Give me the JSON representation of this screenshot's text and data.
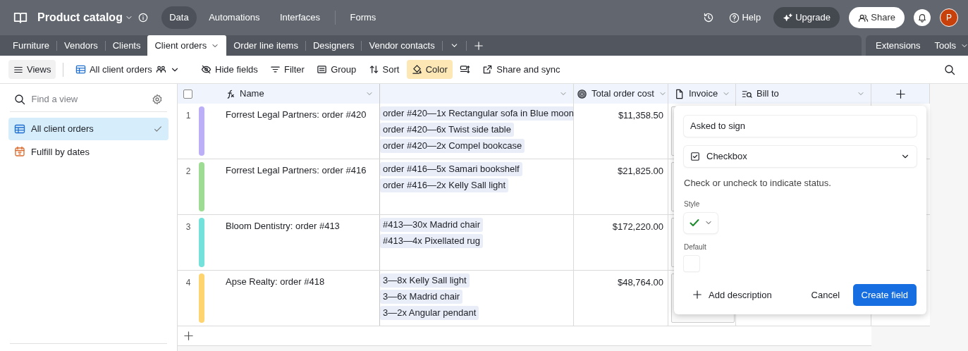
{
  "app": {
    "title": "Product catalog",
    "nav": [
      {
        "label": "Data",
        "selected": true
      },
      {
        "label": "Automations",
        "selected": false
      },
      {
        "label": "Interfaces",
        "selected": false
      },
      {
        "label": "Forms",
        "selected": false
      }
    ]
  },
  "header_actions": {
    "help": "Help",
    "upgrade": "Upgrade",
    "share": "Share",
    "avatar": "P"
  },
  "tables": [
    {
      "label": "Furniture",
      "selected": false
    },
    {
      "label": "Vendors",
      "selected": false
    },
    {
      "label": "Clients",
      "selected": false
    },
    {
      "label": "Client orders",
      "selected": true
    },
    {
      "label": "Order line items",
      "selected": false
    },
    {
      "label": "Designers",
      "selected": false
    },
    {
      "label": "Vendor contacts",
      "selected": false
    }
  ],
  "table_tools": [
    "Extensions",
    "Tools"
  ],
  "toolbar": {
    "views": "Views",
    "current_view": "All client orders",
    "buttons": [
      {
        "label": "Hide fields",
        "active": false
      },
      {
        "label": "Filter",
        "active": false
      },
      {
        "label": "Group",
        "active": false
      },
      {
        "label": "Sort",
        "active": false
      },
      {
        "label": "Color",
        "active": true
      },
      {
        "active": false
      },
      {
        "label": "Share and sync",
        "active": false
      }
    ]
  },
  "sidebar": {
    "search_placeholder": "Find a view",
    "views": [
      {
        "label": "All client orders",
        "kind": "grid",
        "selected": true
      },
      {
        "label": "Fulfill by dates",
        "kind": "calendar",
        "selected": false
      }
    ]
  },
  "grid": {
    "all_selected": false,
    "columns": [
      {
        "label": "Name",
        "kind": "formula"
      },
      {
        "kind": "link"
      },
      {
        "label": "Total order cost",
        "kind": "rollup"
      },
      {
        "label": "Invoice",
        "kind": "attachment"
      },
      {
        "label": "Bill to",
        "kind": "lookup"
      }
    ],
    "rows": [
      {
        "number": "1",
        "color": "#bcaef7",
        "name": "Forrest Legal Partners: order #420",
        "line_items": [
          "order #420—1x Rectangular sofa in Blue moon",
          "order #420—6x Twist side table",
          "order #420—2x Compel bookcase"
        ],
        "total": "$11,358.50"
      },
      {
        "number": "2",
        "color": "#9edb93",
        "name": "Forrest Legal Partners: order #416",
        "line_items": [
          "order #416—5x Samari bookshelf",
          "order #416—2x Kelly Sall light"
        ],
        "total": "$21,825.00"
      },
      {
        "number": "3",
        "color": "#74e1da",
        "name": "Bloom Dentistry: order #413",
        "line_items": [
          "#413—30x Madrid chair",
          "#413—4x Pixellated rug"
        ],
        "total": "$172,220.00"
      },
      {
        "number": "4",
        "color": "#fdd470",
        "name": "Apse Realty: order #418",
        "line_items": [
          "3—8x Kelly Sall light",
          "3—6x Madrid chair",
          "3—2x Angular pendant"
        ],
        "total": "$48,764.00"
      }
    ]
  },
  "new_field": {
    "field_name": "Asked to sign",
    "field_type": "Checkbox",
    "description": "Check or uncheck to indicate status.",
    "style_label": "Style",
    "default_label": "Default",
    "default_checked": false,
    "add_description": "Add description",
    "cancel": "Cancel",
    "create": "Create field"
  }
}
